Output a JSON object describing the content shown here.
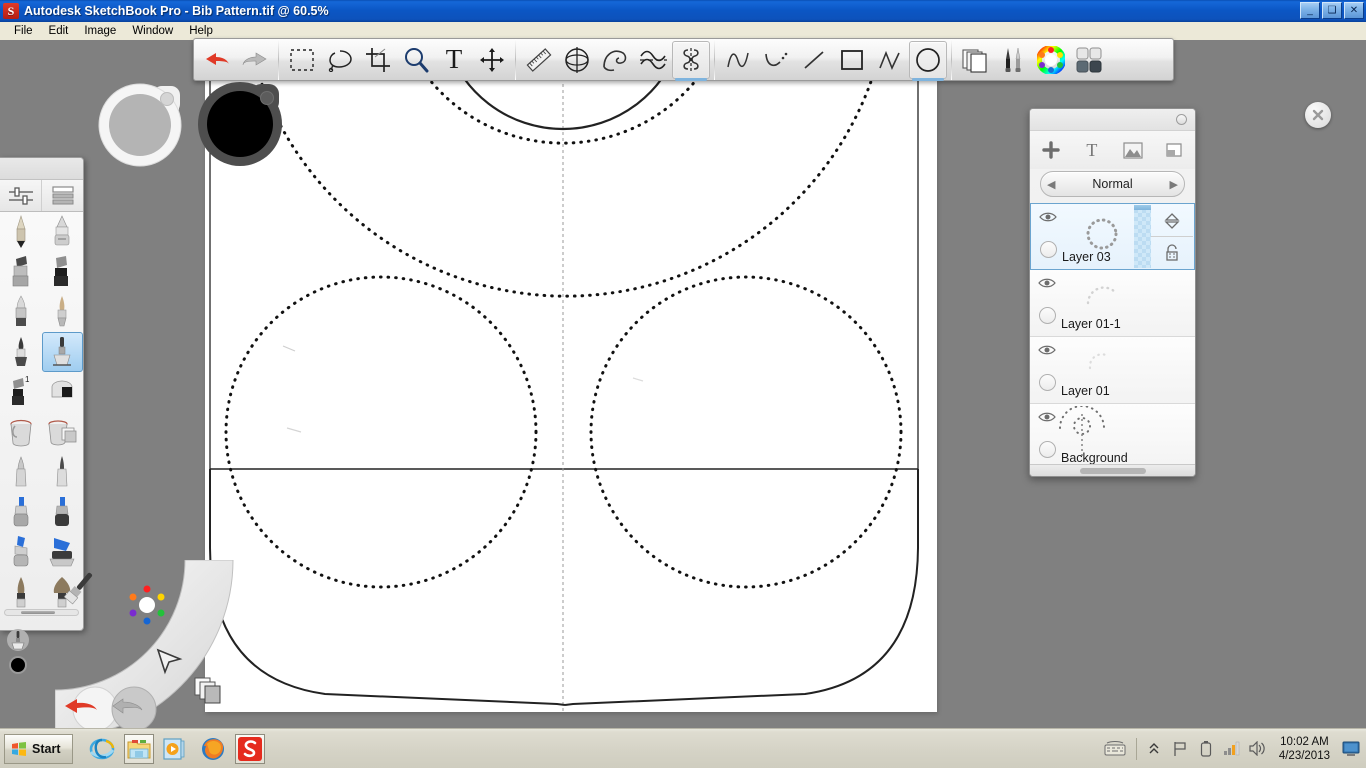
{
  "window": {
    "app_icon": "sketchbook-logo-icon",
    "title": "Autodesk SketchBook Pro - Bib Pattern.tif @ 60.5%",
    "minimize_label": "_",
    "maximize_label": "❑",
    "close_label": "✕"
  },
  "menu": {
    "items": [
      {
        "label": "File",
        "name": "menu-file"
      },
      {
        "label": "Edit",
        "name": "menu-edit"
      },
      {
        "label": "Image",
        "name": "menu-image"
      },
      {
        "label": "Window",
        "name": "menu-window"
      },
      {
        "label": "Help",
        "name": "menu-help"
      }
    ]
  },
  "toolbar": {
    "groups": [
      {
        "name": "history-group",
        "buttons": [
          {
            "name": "undo-icon",
            "label": "Undo",
            "selected": false
          },
          {
            "name": "redo-icon",
            "label": "Redo",
            "selected": false
          }
        ]
      },
      {
        "name": "selection-group",
        "buttons": [
          {
            "name": "rectangle-select-icon",
            "label": "Rectangle Select",
            "selected": false
          },
          {
            "name": "lasso-select-icon",
            "label": "Lasso Select",
            "selected": false
          },
          {
            "name": "crop-icon",
            "label": "Crop",
            "selected": false
          },
          {
            "name": "zoom-icon",
            "label": "Zoom",
            "selected": false
          },
          {
            "name": "text-icon",
            "label": "Text",
            "selected": false
          },
          {
            "name": "transform-icon",
            "label": "Transform",
            "selected": false
          }
        ]
      },
      {
        "name": "guides-group",
        "buttons": [
          {
            "name": "ruler-icon",
            "label": "Ruler",
            "selected": false
          },
          {
            "name": "ellipse-guide-icon",
            "label": "Ellipse Guide",
            "selected": false
          },
          {
            "name": "french-curve-icon",
            "label": "French Curve",
            "selected": false
          },
          {
            "name": "predictive-stroke-icon",
            "label": "Predictive Stroke",
            "selected": false
          },
          {
            "name": "symmetry-y-icon",
            "label": "Symmetry Y",
            "selected": true
          }
        ]
      },
      {
        "name": "shapes-group",
        "buttons": [
          {
            "name": "freeform-icon",
            "label": "Freeform",
            "selected": false
          },
          {
            "name": "curve-icon",
            "label": "Curve",
            "selected": false
          },
          {
            "name": "line-icon",
            "label": "Line",
            "selected": false
          },
          {
            "name": "rectangle-shape-icon",
            "label": "Rectangle",
            "selected": false
          },
          {
            "name": "polyline-icon",
            "label": "Polyline",
            "selected": false
          },
          {
            "name": "ellipse-shape-icon",
            "label": "Ellipse",
            "selected": true
          }
        ]
      },
      {
        "name": "palettes-group",
        "buttons": [
          {
            "name": "layers-panel-icon",
            "label": "Layer Editor",
            "selected": false
          },
          {
            "name": "brush-palette-icon",
            "label": "Brush Palette",
            "selected": false
          },
          {
            "name": "color-wheel-icon",
            "label": "Color Editor",
            "selected": false
          },
          {
            "name": "color-swatches-icon",
            "label": "Color Swatches",
            "selected": false
          }
        ]
      }
    ]
  },
  "brush_palette": {
    "tabs": [
      {
        "name": "brush-properties-tab",
        "label": "Brush Properties"
      },
      {
        "name": "brush-library-tab",
        "label": "Brush Library"
      }
    ],
    "brushes": [
      {
        "name": "pencil-brush",
        "label": "Pencil",
        "selected": false
      },
      {
        "name": "chisel-marker-brush",
        "label": "Chisel Tip Marker",
        "selected": false
      },
      {
        "name": "marker-brush",
        "label": "Marker",
        "selected": false
      },
      {
        "name": "flat-brush",
        "label": "Flat Brush",
        "selected": false
      },
      {
        "name": "eraser-hard-brush",
        "label": "Hard Eraser",
        "selected": false
      },
      {
        "name": "paintbrush-brush",
        "label": "Paintbrush",
        "selected": false
      },
      {
        "name": "soft-eraser-brush",
        "label": "Soft Eraser",
        "selected": false
      },
      {
        "name": "airbrush-brush",
        "label": "Airbrush",
        "selected": true
      },
      {
        "name": "eraser-block-1-brush",
        "label": "Eraser 1",
        "selected": false
      },
      {
        "name": "eraser-block-brush",
        "label": "Eraser Block",
        "selected": false
      },
      {
        "name": "paint-bucket-tool",
        "label": "Fill",
        "selected": false
      },
      {
        "name": "gradient-fill-tool",
        "label": "Gradient Fill",
        "selected": false
      },
      {
        "name": "steel-nib-brush",
        "label": "Steel Nib",
        "selected": false
      },
      {
        "name": "steel-nib-fine-brush",
        "label": "Fine Steel Nib",
        "selected": false
      },
      {
        "name": "blue-marker-brush",
        "label": "Blue Marker",
        "selected": false
      },
      {
        "name": "blue-marker-dark-brush",
        "label": "Dark Blue Marker",
        "selected": false
      },
      {
        "name": "blue-highlighter-brush",
        "label": "Blue Highlighter",
        "selected": false
      },
      {
        "name": "blue-wedge-brush",
        "label": "Blue Wedge",
        "selected": false
      },
      {
        "name": "bristle-brush",
        "label": "Bristle Brush",
        "selected": false
      },
      {
        "name": "fan-brush",
        "label": "Fan Brush",
        "selected": false
      }
    ],
    "scrollbar": {
      "name": "brush-palette-scrollbar"
    }
  },
  "pucks": {
    "gray_puck": {
      "name": "brush-size-puck",
      "label": "Brush Size Puck"
    },
    "black_puck": {
      "name": "brush-color-puck",
      "label": "Brush Color Puck",
      "color": "#000000"
    },
    "tool_puck": {
      "name": "current-tool-puck",
      "label": "Current Tool"
    },
    "color_puck": {
      "name": "current-color-puck",
      "label": "Current Color",
      "color": "#000000"
    }
  },
  "lagoon": {
    "items": [
      {
        "name": "brush-lagoon-icon",
        "label": "Brush"
      },
      {
        "name": "color-wheel-lagoon-icon",
        "label": "Color"
      },
      {
        "name": "cursor-lagoon-icon",
        "label": "Selection"
      },
      {
        "name": "layers-lagoon-icon",
        "label": "Layers"
      },
      {
        "name": "undo-lagoon-button",
        "label": "Undo"
      },
      {
        "name": "redo-lagoon-button",
        "label": "Redo"
      }
    ]
  },
  "layers_panel": {
    "title": "Layer Editor",
    "collapse_button": "collapse-icon",
    "tools": [
      {
        "name": "add-layer-button",
        "label": "+"
      },
      {
        "name": "add-text-layer-button",
        "label": "T"
      },
      {
        "name": "import-image-button",
        "label": "Import Image"
      },
      {
        "name": "layer-menu-button",
        "label": "Layer Menu"
      }
    ],
    "blend_mode": {
      "prev_label": "◀",
      "value": "Normal",
      "next_label": "▶"
    },
    "layers": [
      {
        "name": "Layer 03",
        "selected": true,
        "visible": true,
        "thumb": "dotted-ring"
      },
      {
        "name": "Layer 01-1",
        "selected": false,
        "visible": true,
        "thumb": "faint-arc"
      },
      {
        "name": "Layer 01",
        "selected": false,
        "visible": true,
        "thumb": "faint-dots"
      },
      {
        "name": "Background",
        "selected": false,
        "visible": true,
        "thumb": "bib-sketch"
      }
    ],
    "row_controls": {
      "opacity_slider": "layer-opacity-slider",
      "move_handle": "layer-reorder-handle",
      "lock_toggle": "layer-lock-icon"
    },
    "scrollbar": "layers-horizontal-scrollbar"
  },
  "canvas": {
    "name": "drawing-canvas",
    "zoom": "60.5%",
    "document_name": "Bib Pattern.tif",
    "close_button": {
      "name": "close-canvas-button",
      "label": "✕"
    }
  },
  "taskbar": {
    "start": {
      "label": "Start",
      "name": "start-button"
    },
    "quick_launch": [
      {
        "name": "internet-explorer-icon",
        "label": "Internet Explorer",
        "framed": false
      },
      {
        "name": "file-explorer-icon",
        "label": "Windows Explorer",
        "framed": true
      },
      {
        "name": "media-player-icon",
        "label": "Windows Media Player",
        "framed": false
      },
      {
        "name": "firefox-icon",
        "label": "Mozilla Firefox",
        "framed": false
      },
      {
        "name": "sketchbook-taskbar-icon",
        "label": "Autodesk SketchBook Pro",
        "framed": true
      }
    ],
    "tray": [
      {
        "name": "show-hidden-icons-icon",
        "label": "»"
      },
      {
        "name": "action-flag-icon",
        "label": "Action Center"
      },
      {
        "name": "battery-icon",
        "label": "Battery"
      },
      {
        "name": "network-icon",
        "label": "Network"
      },
      {
        "name": "volume-icon",
        "label": "Volume"
      }
    ],
    "keyboard_icon": {
      "name": "tablet-keyboard-icon",
      "label": "Touch Keyboard"
    },
    "clock": {
      "time": "10:02 AM",
      "date": "4/23/2013",
      "name": "clock"
    },
    "show_desktop": {
      "name": "show-desktop-button",
      "label": "Show Desktop"
    }
  },
  "colors": {
    "titlebar_blue": "#0d52bb",
    "desktop_gray": "#808080",
    "taskbar": "#d5d3c6",
    "selection_blue": "#9fcdf0",
    "accent_underline": "#7fb4de"
  }
}
